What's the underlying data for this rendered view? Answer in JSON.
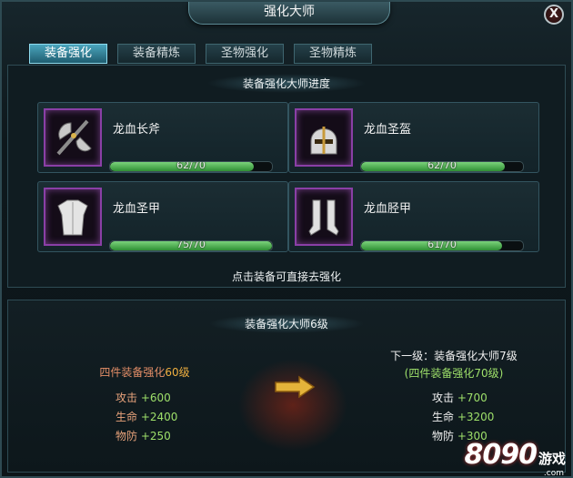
{
  "window": {
    "title": "强化大师",
    "close_label": "X"
  },
  "tabs": [
    {
      "label": "装备强化",
      "active": true
    },
    {
      "label": "装备精炼",
      "active": false
    },
    {
      "label": "圣物强化",
      "active": false
    },
    {
      "label": "圣物精炼",
      "active": false
    }
  ],
  "progress_section": {
    "title": "装备强化大师进度",
    "items": [
      {
        "name": "龙血长斧",
        "progress_text": "62/70",
        "current": 62,
        "max": 70,
        "icon": "battle-axe-icon"
      },
      {
        "name": "龙血圣盔",
        "progress_text": "62/70",
        "current": 62,
        "max": 70,
        "icon": "helmet-icon"
      },
      {
        "name": "龙血圣甲",
        "progress_text": "75/70",
        "current": 75,
        "max": 70,
        "icon": "armor-icon"
      },
      {
        "name": "龙血胫甲",
        "progress_text": "61/70",
        "current": 61,
        "max": 70,
        "icon": "greaves-icon"
      }
    ],
    "hint": "点击装备可直接去强化"
  },
  "master_section": {
    "title": "装备强化大师6级",
    "current": {
      "requirement_prefix": "四件装备强化",
      "requirement_value": "60级",
      "stats": [
        {
          "label": "攻击",
          "value": "+600"
        },
        {
          "label": "生命",
          "value": "+2400"
        },
        {
          "label": "物防",
          "value": "+250"
        }
      ]
    },
    "next": {
      "title": "下一级：装备强化大师7级",
      "requirement": "(四件装备强化70级)",
      "stats": [
        {
          "label": "攻击",
          "value": "+700"
        },
        {
          "label": "生命",
          "value": "+3200"
        },
        {
          "label": "物防",
          "value": "+300"
        }
      ]
    }
  },
  "watermark": {
    "number": "8090",
    "word": "游戏",
    "domain": ".com"
  },
  "colors": {
    "accent_tab": "#4aa5bd",
    "bar_fill": "#3fa444",
    "icon_border": "#8a3fa6",
    "bonus_value": "#9ee06a",
    "requirement": "#e58f68"
  }
}
